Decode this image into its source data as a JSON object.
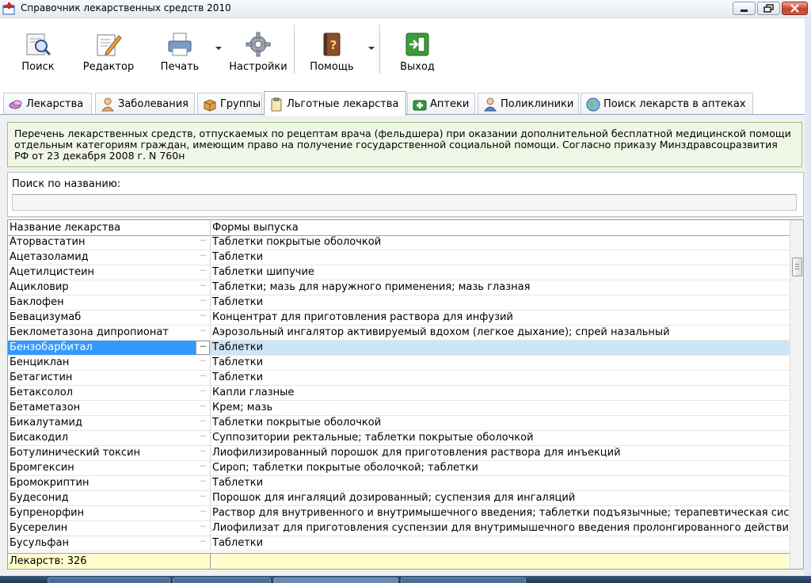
{
  "window": {
    "title": "Справочник лекарственных средств 2010",
    "accent": "#3399ff"
  },
  "toolbar": {
    "search": "Поиск",
    "editor": "Редактор",
    "print": "Печать",
    "settings": "Настройки",
    "help": "Помощь",
    "exit": "Выход"
  },
  "tabs": [
    {
      "label": "Лекарства",
      "icon": "pills-icon"
    },
    {
      "label": "Заболевания",
      "icon": "person-icon"
    },
    {
      "label": "Группы",
      "icon": "box-icon"
    },
    {
      "label": "Льготные лекарства",
      "icon": "clipboard-icon",
      "active": true
    },
    {
      "label": "Аптеки",
      "icon": "first-aid-icon"
    },
    {
      "label": "Поликлиники",
      "icon": "doctor-icon"
    },
    {
      "label": "Поиск лекарств в аптеках",
      "icon": "globe-icon"
    }
  ],
  "info_text": "Перечень лекарственных средств, отпускаемых по рецептам врача (фельдшера) при оказании дополнительной бесплатной медицинской помощи отдельным категориям граждан, имеющим право на получение государственной социальной помощи. Согласно приказу Минздравсоцразвития РФ от 23 декабря 2008 г. N 760н",
  "search": {
    "label": "Поиск по названию:",
    "value": ""
  },
  "table": {
    "headers": [
      "Название лекарства",
      "Формы выпуска"
    ],
    "selected_index": 7,
    "rows": [
      [
        "Аторвастатин",
        "Таблетки покрытые оболочкой"
      ],
      [
        "Ацетазоламид",
        "Таблетки"
      ],
      [
        "Ацетилцистеин",
        "Таблетки шипучие"
      ],
      [
        "Ацикловир",
        "Таблетки; мазь для наружного применения; мазь глазная"
      ],
      [
        "Баклофен",
        "Таблетки"
      ],
      [
        "Бевацизумаб",
        "Концентрат для приготовления раствора для инфузий"
      ],
      [
        "Беклометазона дипропионат",
        "Аэрозольный ингалятор активируемый вдохом (легкое дыхание); спрей назальный"
      ],
      [
        "Бензобарбитал",
        "Таблетки"
      ],
      [
        "Бенциклан",
        "Таблетки"
      ],
      [
        "Бетагистин",
        "Таблетки"
      ],
      [
        "Бетаксолол",
        "Капли глазные"
      ],
      [
        "Бетаметазон",
        "Крем; мазь"
      ],
      [
        "Бикалутамид",
        "Таблетки покрытые оболочкой"
      ],
      [
        "Бисакодил",
        "Суппозитории ректальные; таблетки покрытые оболочкой"
      ],
      [
        "Ботулинический токсин",
        "Лиофилизированный порошок для приготовления раствора для инъекций"
      ],
      [
        "Бромгексин",
        "Сироп; таблетки покрытые оболочкой; таблетки"
      ],
      [
        "Бромокриптин",
        "Таблетки"
      ],
      [
        "Будесонид",
        "Порошок для ингаляций дозированный; суспензия для ингаляций"
      ],
      [
        "Бупренорфин",
        "Раствор для внутривенного и внутримышечного введения; таблетки подъязычные; терапевтическая сист"
      ],
      [
        "Бусерелин",
        "Лиофилизат для приготовления суспензии для внутримышечного введения пролонгированного действия"
      ],
      [
        "Бусульфан",
        "Таблетки"
      ]
    ],
    "footer": "Лекарств: 326"
  }
}
